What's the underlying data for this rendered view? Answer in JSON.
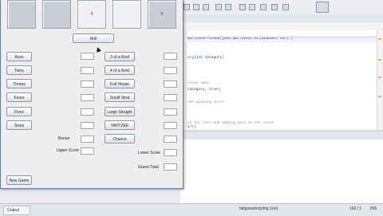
{
  "game": {
    "dice": [
      "",
      "",
      "4",
      "",
      "5"
    ],
    "roll_label": "Roll",
    "upper": [
      {
        "label": "Aces"
      },
      {
        "label": "Twos"
      },
      {
        "label": "Threes"
      },
      {
        "label": "Fours"
      },
      {
        "label": "Fives"
      },
      {
        "label": "Sixes"
      }
    ],
    "lower": [
      {
        "label": "3 of a Kind"
      },
      {
        "label": "4 of a Kind"
      },
      {
        "label": "Full House"
      },
      {
        "label": "Small Strat"
      },
      {
        "label": "Large Straight"
      },
      {
        "label": "YAHTZEE"
      },
      {
        "label": "Chance"
      }
    ],
    "bonus_label": "Bonus",
    "upper_score_label": "Upper Score",
    "lower_score_label": "Lower Score",
    "grand_total_label": "Grand Total",
    "new_game_label": "New Game"
  },
  "editor": {
    "lines": [
      "ButtonPerformed(java.awt.event.ActionEvent evt) {",
      "",
      "",
      "ory(int category)",
      "",
      "",
      "",
      "cores open",
      "category, true);",
      "",
      "the winning score",
      "",
      "",
      "",
      "ch for once and adding once in the score",
      "i++)"
    ]
  },
  "status": {
    "output_tab": "Output",
    "mode": "INS",
    "position": "163 | 1",
    "progress_text": "fatigewishstyling (run)"
  }
}
